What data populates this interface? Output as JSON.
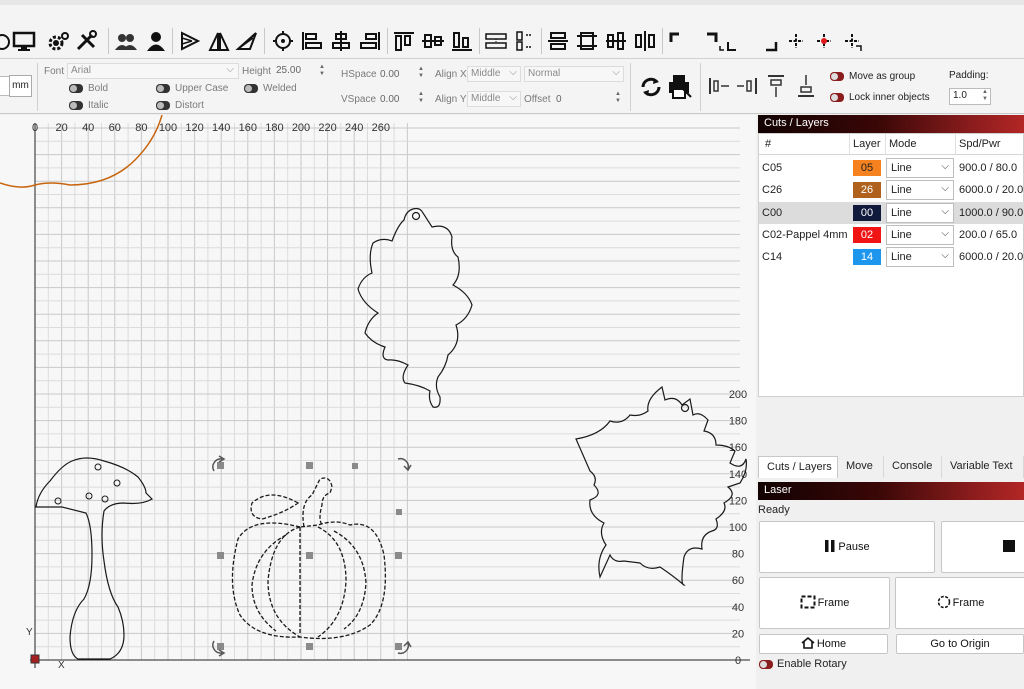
{
  "toolbar2": {
    "unit": "mm",
    "font_label": "Font",
    "font_value": "Arial",
    "height_label": "Height",
    "height_value": "25.00",
    "hspace_label": "HSpace",
    "hspace_value": "0.00",
    "vspace_label": "VSpace",
    "vspace_value": "0.00",
    "alignx_label": "Align X",
    "alignx_value": "Middle",
    "aligny_label": "Align Y",
    "aligny_value": "Middle",
    "style_value": "Normal",
    "offset_label": "Offset",
    "offset_value": "0",
    "bold_label": "Bold",
    "italic_label": "Italic",
    "uppercase_label": "Upper Case",
    "distort_label": "Distort",
    "welded_label": "Welded",
    "move_as_group_label": "Move as group",
    "lock_inner_label": "Lock inner objects",
    "padding_label": "Padding:",
    "padding_value": "1.0"
  },
  "ruler": {
    "x_ticks": [
      "0",
      "20",
      "40",
      "60",
      "80",
      "100",
      "120",
      "140",
      "160",
      "180",
      "200",
      "220",
      "240",
      "260"
    ],
    "y_ticks": [
      "200",
      "180",
      "160",
      "140",
      "120",
      "100",
      "80",
      "60",
      "40",
      "20",
      "0"
    ],
    "x_axis": "X",
    "y_axis": "Y"
  },
  "cuts_panel": {
    "title": "Cuts / Layers",
    "columns": [
      "#",
      "Layer",
      "Mode",
      "Spd/Pwr"
    ],
    "rows": [
      {
        "name": "C05",
        "layer": "05",
        "color": "#f5821f",
        "text_color": "#222222",
        "mode": "Line",
        "spd_pwr": "900.0 / 80.0"
      },
      {
        "name": "C26",
        "layer": "26",
        "color": "#b0621d",
        "text_color": "#ffffff",
        "mode": "Line",
        "spd_pwr": "6000.0 / 20.0"
      },
      {
        "name": "C00",
        "layer": "00",
        "color": "#101a3a",
        "text_color": "#ffffff",
        "mode": "Line",
        "spd_pwr": "1000.0 / 90.0"
      },
      {
        "name": "C02-Pappel 4mm",
        "layer": "02",
        "color": "#f01414",
        "text_color": "#ffffff",
        "mode": "Line",
        "spd_pwr": "200.0 / 65.0"
      },
      {
        "name": "C14",
        "layer": "14",
        "color": "#1e96ee",
        "text_color": "#ffffff",
        "mode": "Line",
        "spd_pwr": "6000.0 / 20.0"
      }
    ]
  },
  "tabs": [
    "Cuts / Layers",
    "Move",
    "Console",
    "Variable Text"
  ],
  "laser_panel": {
    "title": "Laser",
    "status": "Ready",
    "pause_label": "Pause",
    "frame_label": "Frame",
    "frame2_label": "Frame",
    "home_label": "Home",
    "origin_label": "Go to Origin",
    "rotary_label": "Enable Rotary"
  }
}
